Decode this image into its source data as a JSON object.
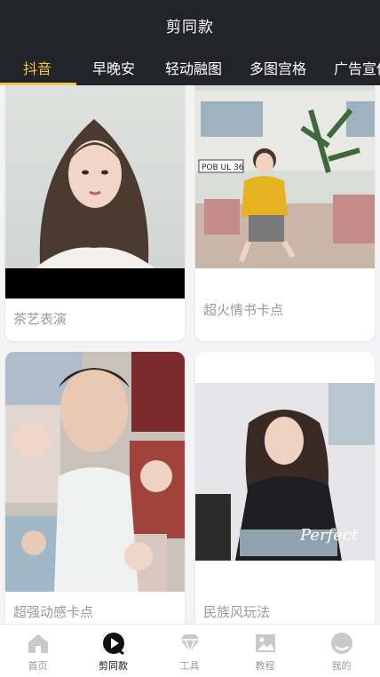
{
  "header": {
    "title": "剪同款",
    "tabs": [
      {
        "label": "抖音",
        "active": true
      },
      {
        "label": "早晚安",
        "active": false
      },
      {
        "label": "轻动融图",
        "active": false
      },
      {
        "label": "多图宫格",
        "active": false
      },
      {
        "label": "广告宣传",
        "active": false
      }
    ]
  },
  "cards": [
    {
      "title": "茶艺表演",
      "photo": "portrait-long-hair-woman"
    },
    {
      "title": "超火情书卡点",
      "photo": "woman-yellow-sweater-outdoors",
      "sign_text": "POB UL 36"
    },
    {
      "title": "超强动感卡点",
      "photo": "collage-of-portraits"
    },
    {
      "title": "民族风玩法",
      "photo": "woman-sitting-black-jacket",
      "overlay_text": "Perfect"
    }
  ],
  "bottom_nav": [
    {
      "label": "首页",
      "icon": "home-icon",
      "active": false
    },
    {
      "label": "剪同款",
      "icon": "play-circle-icon",
      "active": true
    },
    {
      "label": "工具",
      "icon": "diamond-icon",
      "active": false
    },
    {
      "label": "教程",
      "icon": "image-icon",
      "active": false
    },
    {
      "label": "我的",
      "icon": "profile-icon",
      "active": false
    }
  ],
  "colors": {
    "header_bg": "#232429",
    "accent": "#f2c44a",
    "label_gray": "#9a9a9a",
    "active_nav": "#111111"
  }
}
